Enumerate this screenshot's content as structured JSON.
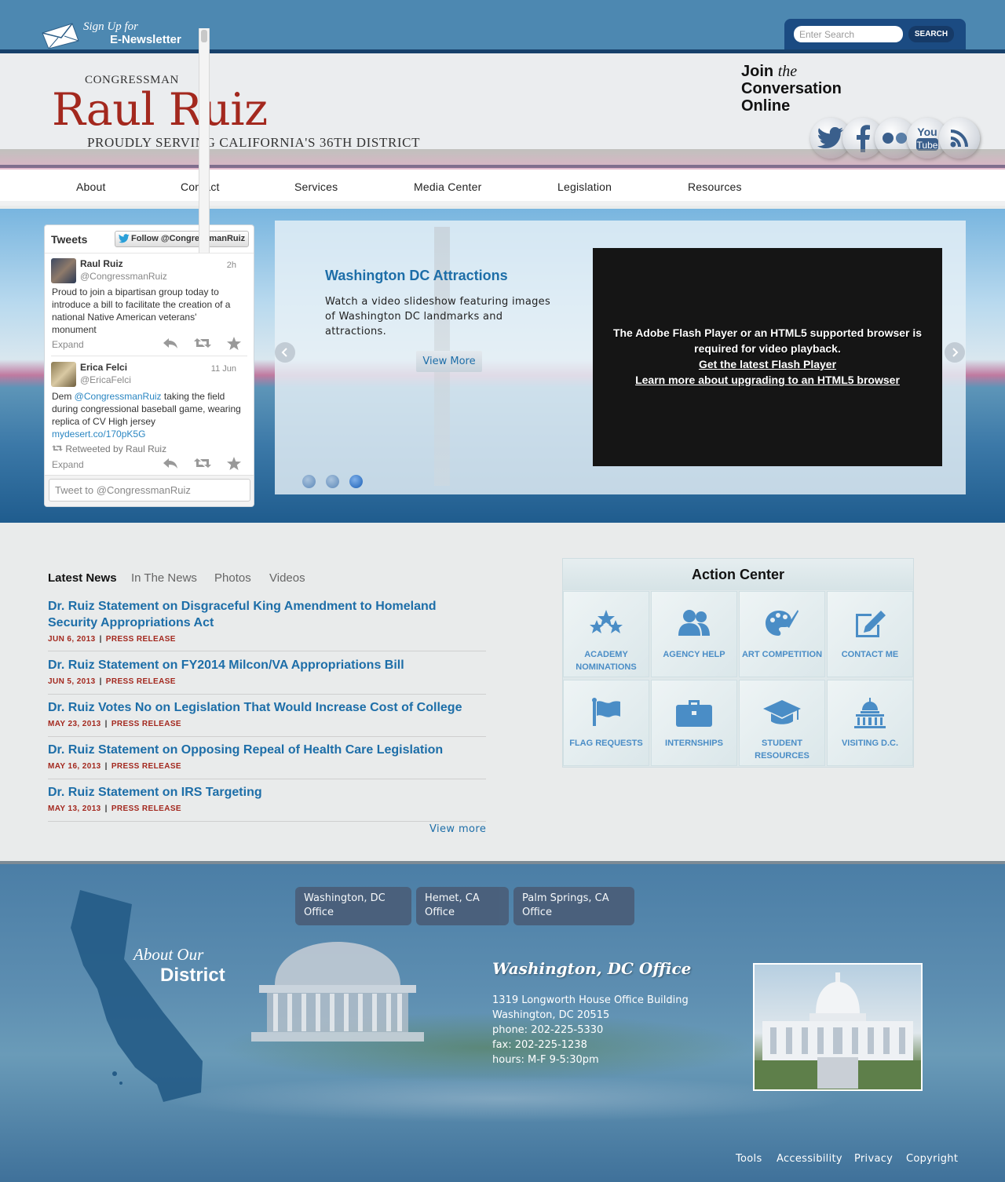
{
  "topbar": {
    "newsletter_line1": "Sign Up for",
    "newsletter_line2": "E-Newsletter",
    "search_placeholder": "Enter Search",
    "search_button": "SEARCH"
  },
  "header": {
    "congressman_label": "CONGRESSMAN",
    "name": "Raul Ruiz",
    "tagline": "PROUDLY SERVING CALIFORNIA'S 36TH DISTRICT",
    "join_1": "Join",
    "join_the": "the",
    "join_2": "Conversation",
    "join_3": "Online",
    "social": [
      "twitter-icon",
      "facebook-icon",
      "flickr-icon",
      "youtube-icon",
      "rss-icon"
    ]
  },
  "nav": {
    "items": [
      "About",
      "Contact",
      "Services",
      "Media Center",
      "Legislation",
      "Resources"
    ]
  },
  "twitter": {
    "title": "Tweets",
    "follow": "Follow @CongressmanRuiz",
    "tweets": [
      {
        "name": "Raul Ruiz",
        "handle": "@CongressmanRuiz",
        "time": "2h",
        "text": "Proud to join a bipartisan group today to introduce a bill to facilitate the creation of a national Native American veterans' monument",
        "expand": "Expand"
      },
      {
        "name": "Erica Felci",
        "handle": "@EricaFelci",
        "time": "11 Jun",
        "text_pre": "Dem ",
        "text_mention": "@CongressmanRuiz",
        "text_post": " taking the field during congressional baseball game, wearing replica of CV High jersey",
        "link": "mydesert.co/170pK5G",
        "retweeted": "Retweeted by Raul Ruiz",
        "expand": "Expand"
      }
    ],
    "compose_placeholder": "Tweet to @CongressmanRuiz"
  },
  "slideshow": {
    "title": "Washington DC Attractions",
    "description": "Watch a video slideshow featuring images of Washington DC landmarks and attractions.",
    "button": "View More",
    "video_message": "The Adobe Flash Player or an HTML5 supported browser is required for video playback.",
    "video_link1": "Get the latest Flash Player",
    "video_link2": "Learn more about upgrading to an HTML5 browser",
    "dots": 3,
    "active_dot": 3
  },
  "news": {
    "tabs": [
      "Latest News",
      "In The News",
      "Photos",
      "Videos"
    ],
    "active_tab": "Latest News",
    "items": [
      {
        "title": "Dr. Ruiz Statement on Disgraceful King Amendment to Homeland Security Appropriations Act",
        "date": "JUN 6, 2013",
        "type": "PRESS RELEASE"
      },
      {
        "title": "Dr. Ruiz Statement on FY2014 Milcon/VA Appropriations Bill",
        "date": "JUN 5, 2013",
        "type": "PRESS RELEASE"
      },
      {
        "title": "Dr. Ruiz Votes No on Legislation That Would Increase Cost of College",
        "date": "MAY 23, 2013",
        "type": "PRESS RELEASE"
      },
      {
        "title": "Dr. Ruiz Statement on Opposing Repeal of Health Care Legislation",
        "date": "MAY 16, 2013",
        "type": "PRESS RELEASE"
      },
      {
        "title": "Dr. Ruiz Statement on IRS Targeting",
        "date": "MAY 13, 2013",
        "type": "PRESS RELEASE"
      }
    ],
    "view_more": "View more"
  },
  "action_center": {
    "title": "Action Center",
    "items": [
      {
        "label": "ACADEMY NOMINATIONS",
        "icon": "stars-icon"
      },
      {
        "label": "AGENCY HELP",
        "icon": "people-icon"
      },
      {
        "label": "ART COMPETITION",
        "icon": "palette-icon"
      },
      {
        "label": "CONTACT ME",
        "icon": "edit-icon"
      },
      {
        "label": "FLAG REQUESTS",
        "icon": "flag-icon"
      },
      {
        "label": "INTERNSHIPS",
        "icon": "briefcase-icon"
      },
      {
        "label": "STUDENT RESOURCES",
        "icon": "graduation-cap-icon"
      },
      {
        "label": "VISITING D.C.",
        "icon": "capitol-icon"
      }
    ]
  },
  "footer": {
    "offices": [
      "Washington, DC Office",
      "Hemet, CA Office",
      "Palm Springs, CA Office"
    ],
    "about_1": "About Our",
    "about_2": "District",
    "office_heading": "Washington, DC Office",
    "address_1": "1319 Longworth House Office Building",
    "address_2": "Washington, DC 20515",
    "phone": "phone: 202-225-5330",
    "fax": "fax: 202-225-1238",
    "hours": "hours: M-F 9-5:30pm",
    "links": [
      "Tools",
      "Accessibility",
      "Privacy",
      "Copyright"
    ]
  },
  "colors": {
    "brand_blue": "#17416b",
    "link_blue": "#1d6ea8",
    "accent_red": "#a3281e"
  }
}
